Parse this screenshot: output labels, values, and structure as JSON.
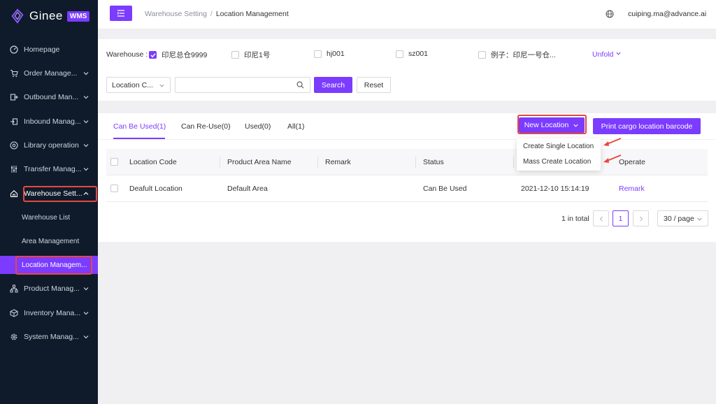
{
  "brand": {
    "name": "Ginee",
    "badge": "WMS"
  },
  "sidebar": {
    "items": [
      {
        "label": "Homepage"
      },
      {
        "label": "Order Manage..."
      },
      {
        "label": "Outbound Man..."
      },
      {
        "label": "Inbound Manag..."
      },
      {
        "label": "Library operation"
      },
      {
        "label": "Transfer Manag..."
      },
      {
        "label": "Warehouse Sett..."
      },
      {
        "label": "Product Manag..."
      },
      {
        "label": "Inventory Mana..."
      },
      {
        "label": "System Manag..."
      }
    ],
    "sub_items": [
      {
        "label": "Warehouse List"
      },
      {
        "label": "Area Management"
      },
      {
        "label": "Location Managem..."
      }
    ]
  },
  "header": {
    "breadcrumb_parent": "Warehouse Setting",
    "breadcrumb_separator": "/",
    "breadcrumb_current": "Location Management",
    "user_email": "cuiping.ma@advance.ai"
  },
  "filter": {
    "warehouse_label": "Warehouse :",
    "warehouses": [
      {
        "label": "印尼总仓9999",
        "checked": true
      },
      {
        "label": "印尼1号",
        "checked": false
      },
      {
        "label": "hj001",
        "checked": false
      },
      {
        "label": "sz001",
        "checked": false
      },
      {
        "label": "例子：印尼一号仓...",
        "checked": false
      }
    ],
    "unfold_label": "Unfold",
    "select_value": "Location C...",
    "search_value": "",
    "search_label": "Search",
    "reset_label": "Reset"
  },
  "tabs": [
    {
      "label": "Can Be Used(1)"
    },
    {
      "label": "Can Re-Use(0)"
    },
    {
      "label": "Used(0)"
    },
    {
      "label": "All(1)"
    }
  ],
  "actions": {
    "new_location_label": "New Location",
    "print_label": "Print cargo location barcode"
  },
  "dropdown": {
    "items": [
      "Create Single Location",
      "Mass Create Location"
    ]
  },
  "table": {
    "headers": {
      "location_code": "Location Code",
      "product_area": "Product Area Name",
      "remark": "Remark",
      "status": "Status",
      "operate": "Operate"
    },
    "rows": [
      {
        "location_code": "Deafult Location",
        "product_area": "Default Area",
        "remark": "",
        "status": "Can Be Used",
        "created": "2021-12-10 15:14:19",
        "operate": "Remark"
      }
    ]
  },
  "pagination": {
    "total_label": "1 in total",
    "current_page": "1",
    "page_size": "30 / page"
  },
  "colors": {
    "accent": "#7b3cff",
    "sidebar_bg": "#0f1b2b",
    "highlight": "#e8473f"
  }
}
